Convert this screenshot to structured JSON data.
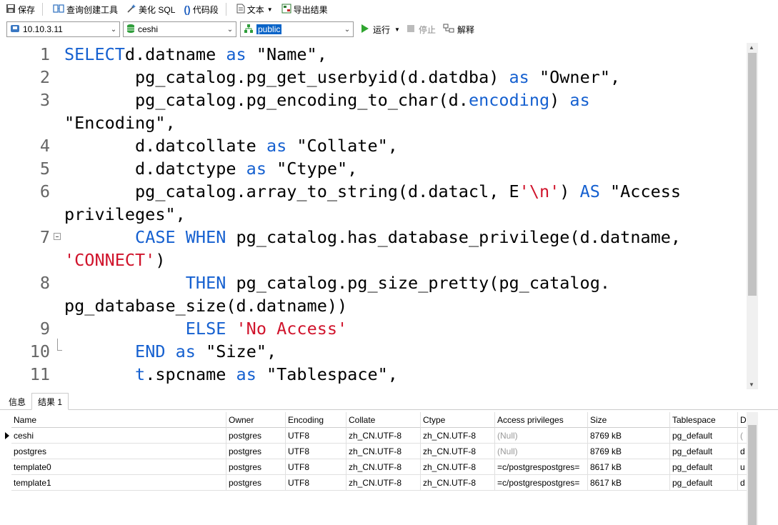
{
  "toolbar": {
    "save": "保存",
    "query_builder": "查询创建工具",
    "beautify_sql": "美化 SQL",
    "code_snippet": "代码段",
    "text": "文本",
    "export": "导出结果"
  },
  "connection_bar": {
    "host": "10.10.3.11",
    "database": "ceshi",
    "schema": "public",
    "run": "运行",
    "stop": "停止",
    "explain": "解释"
  },
  "editor": {
    "lines": [
      {
        "n": "1",
        "parts": [
          [
            "kw",
            "SELECT"
          ],
          [
            "",
            "d.datname "
          ],
          [
            "kw",
            "as"
          ],
          [
            "",
            " \"Name\","
          ]
        ]
      },
      {
        "n": "2",
        "parts": [
          [
            "",
            "       pg_catalog.pg_get_userbyid(d.datdba) "
          ],
          [
            "kw",
            "as"
          ],
          [
            "",
            " \"Owner\","
          ]
        ]
      },
      {
        "n": "3",
        "parts": [
          [
            "",
            "       pg_catalog.pg_encoding_to_char(d."
          ],
          [
            "kw",
            "encoding"
          ],
          [
            "",
            ") "
          ],
          [
            "kw",
            "as"
          ]
        ]
      },
      {
        "n": "",
        "parts": [
          [
            "",
            "\"Encoding\","
          ]
        ]
      },
      {
        "n": "4",
        "parts": [
          [
            "",
            "       d.datcollate "
          ],
          [
            "kw",
            "as"
          ],
          [
            "",
            " \"Collate\","
          ]
        ]
      },
      {
        "n": "5",
        "parts": [
          [
            "",
            "       d.datctype "
          ],
          [
            "kw",
            "as"
          ],
          [
            "",
            " \"Ctype\","
          ]
        ]
      },
      {
        "n": "6",
        "parts": [
          [
            "",
            "       pg_catalog.array_to_string(d.datacl, E"
          ],
          [
            "str",
            "'\\n'"
          ],
          [
            "",
            ") "
          ],
          [
            "kw",
            "AS"
          ],
          [
            "",
            " \"Access"
          ]
        ]
      },
      {
        "n": "",
        "parts": [
          [
            "",
            "privileges\","
          ]
        ]
      },
      {
        "n": "7",
        "parts": [
          [
            "",
            "       "
          ],
          [
            "kw",
            "CASE WHEN"
          ],
          [
            "",
            " pg_catalog.has_database_privilege(d.datname,"
          ]
        ]
      },
      {
        "n": "",
        "parts": [
          [
            "str",
            "'CONNECT'"
          ],
          [
            "",
            ")"
          ]
        ]
      },
      {
        "n": "8",
        "parts": [
          [
            "",
            "            "
          ],
          [
            "kw",
            "THEN"
          ],
          [
            "",
            " pg_catalog.pg_size_pretty(pg_catalog."
          ]
        ]
      },
      {
        "n": "",
        "parts": [
          [
            "",
            "pg_database_size(d.datname))"
          ]
        ]
      },
      {
        "n": "9",
        "parts": [
          [
            "",
            "            "
          ],
          [
            "kw",
            "ELSE"
          ],
          [
            "",
            " "
          ],
          [
            "str",
            "'No Access'"
          ]
        ]
      },
      {
        "n": "10",
        "parts": [
          [
            "",
            "       "
          ],
          [
            "kw",
            "END"
          ],
          [
            "",
            " "
          ],
          [
            "kw",
            "as"
          ],
          [
            "",
            " \"Size\","
          ]
        ]
      },
      {
        "n": "11",
        "parts": [
          [
            "",
            "       "
          ],
          [
            "kw",
            "t"
          ],
          [
            "",
            ".spcname "
          ],
          [
            "kw",
            "as"
          ],
          [
            "",
            " \"Tablespace\","
          ]
        ]
      }
    ]
  },
  "result_tabs": {
    "info": "信息",
    "result1": "结果 1"
  },
  "grid": {
    "columns": [
      "Name",
      "Owner",
      "Encoding",
      "Collate",
      "Ctype",
      "Access privileges",
      "Size",
      "Tablespace",
      "D"
    ],
    "rows": [
      [
        "ceshi",
        "postgres",
        "UTF8",
        "zh_CN.UTF-8",
        "zh_CN.UTF-8",
        "(Null)",
        "8769 kB",
        "pg_default",
        "("
      ],
      [
        "postgres",
        "postgres",
        "UTF8",
        "zh_CN.UTF-8",
        "zh_CN.UTF-8",
        "(Null)",
        "8769 kB",
        "pg_default",
        "d"
      ],
      [
        "template0",
        "postgres",
        "UTF8",
        "zh_CN.UTF-8",
        "zh_CN.UTF-8",
        "=c/postgrespostgres=",
        "8617 kB",
        "pg_default",
        "u"
      ],
      [
        "template1",
        "postgres",
        "UTF8",
        "zh_CN.UTF-8",
        "zh_CN.UTF-8",
        "=c/postgrespostgres=",
        "8617 kB",
        "pg_default",
        "d"
      ]
    ]
  },
  "colors": {
    "keyword": "#1560d0",
    "string": "#d0142c",
    "run_icon": "#2fa52f",
    "db_icon": "#2e9d3a",
    "host_icon": "#3a78c3"
  }
}
